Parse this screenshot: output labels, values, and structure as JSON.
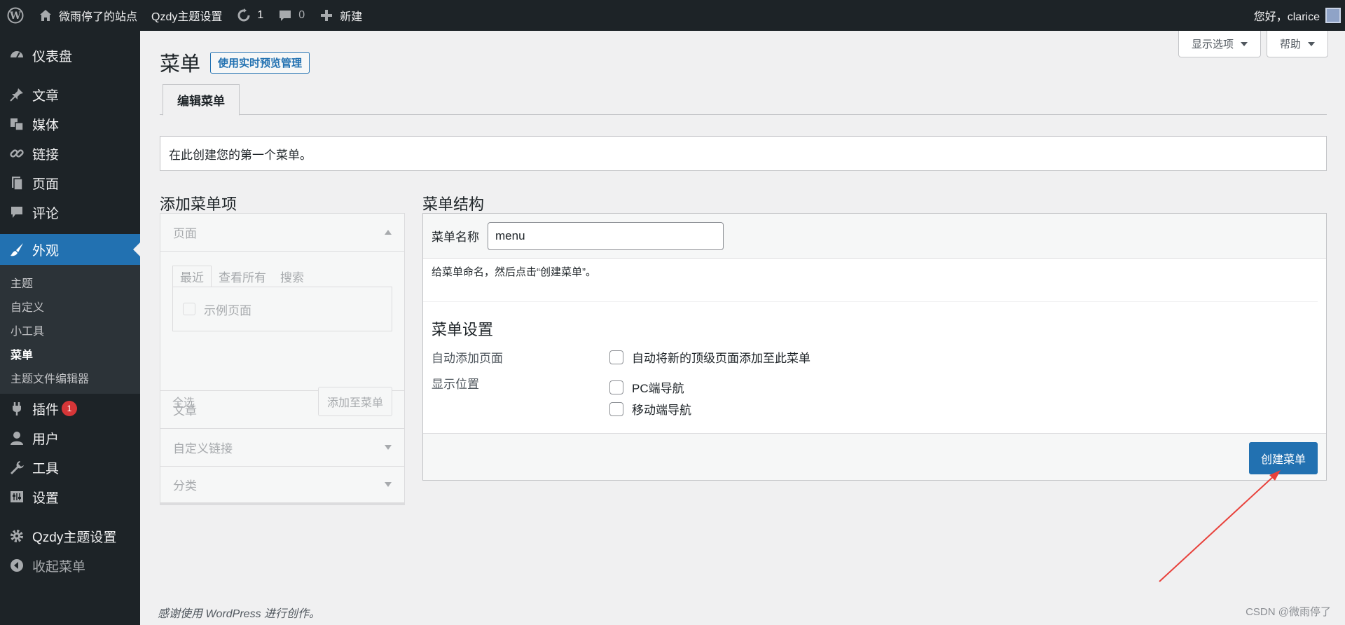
{
  "adminbar": {
    "site_name": "微雨停了的站点",
    "theme_settings": "Qzdy主题设置",
    "updates_count": "1",
    "comments_count": "0",
    "new_label": "新建",
    "greeting": "您好，clarice"
  },
  "sidebar": {
    "dashboard": "仪表盘",
    "posts": "文章",
    "media": "媒体",
    "links": "链接",
    "pages": "页面",
    "comments": "评论",
    "appearance": "外观",
    "submenu": [
      "主题",
      "自定义",
      "小工具",
      "菜单",
      "主题文件编辑器"
    ],
    "plugins": "插件",
    "plugins_badge": "1",
    "users": "用户",
    "tools": "工具",
    "settings": "设置",
    "qzdy_settings": "Qzdy主题设置",
    "collapse": "收起菜单"
  },
  "screen_meta": {
    "screen_options": "显示选项",
    "help": "帮助"
  },
  "page": {
    "title": "菜单",
    "live_preview": "使用实时预览管理",
    "tab_edit": "编辑菜单",
    "notice": "在此创建您的第一个菜单。"
  },
  "add_items": {
    "title": "添加菜单项",
    "pages_head": "页面",
    "tabs": [
      "最近",
      "查看所有",
      "搜索"
    ],
    "sample_page": "示例页面",
    "select_all": "全选",
    "add_to_menu": "添加至菜单",
    "posts_head": "文章",
    "custom_links_head": "自定义链接",
    "categories_head": "分类"
  },
  "menu_structure": {
    "title": "菜单结构",
    "name_label": "菜单名称",
    "name_value": "menu",
    "hint": "给菜单命名，然后点击“创建菜单”。",
    "settings_title": "菜单设置",
    "auto_add_label": "自动添加页面",
    "auto_add_option": "自动将新的顶级页面添加至此菜单",
    "display_location_label": "显示位置",
    "locations": [
      "PC端导航",
      "移动端导航"
    ],
    "create_button": "创建菜单"
  },
  "footer": {
    "thanks": "感谢使用 WordPress 进行创作。",
    "watermark": "CSDN @微雨停了"
  },
  "colors": {
    "accent": "#2271b1",
    "adminbar_bg": "#1d2327",
    "annotation_arrow": "#e8413b"
  }
}
